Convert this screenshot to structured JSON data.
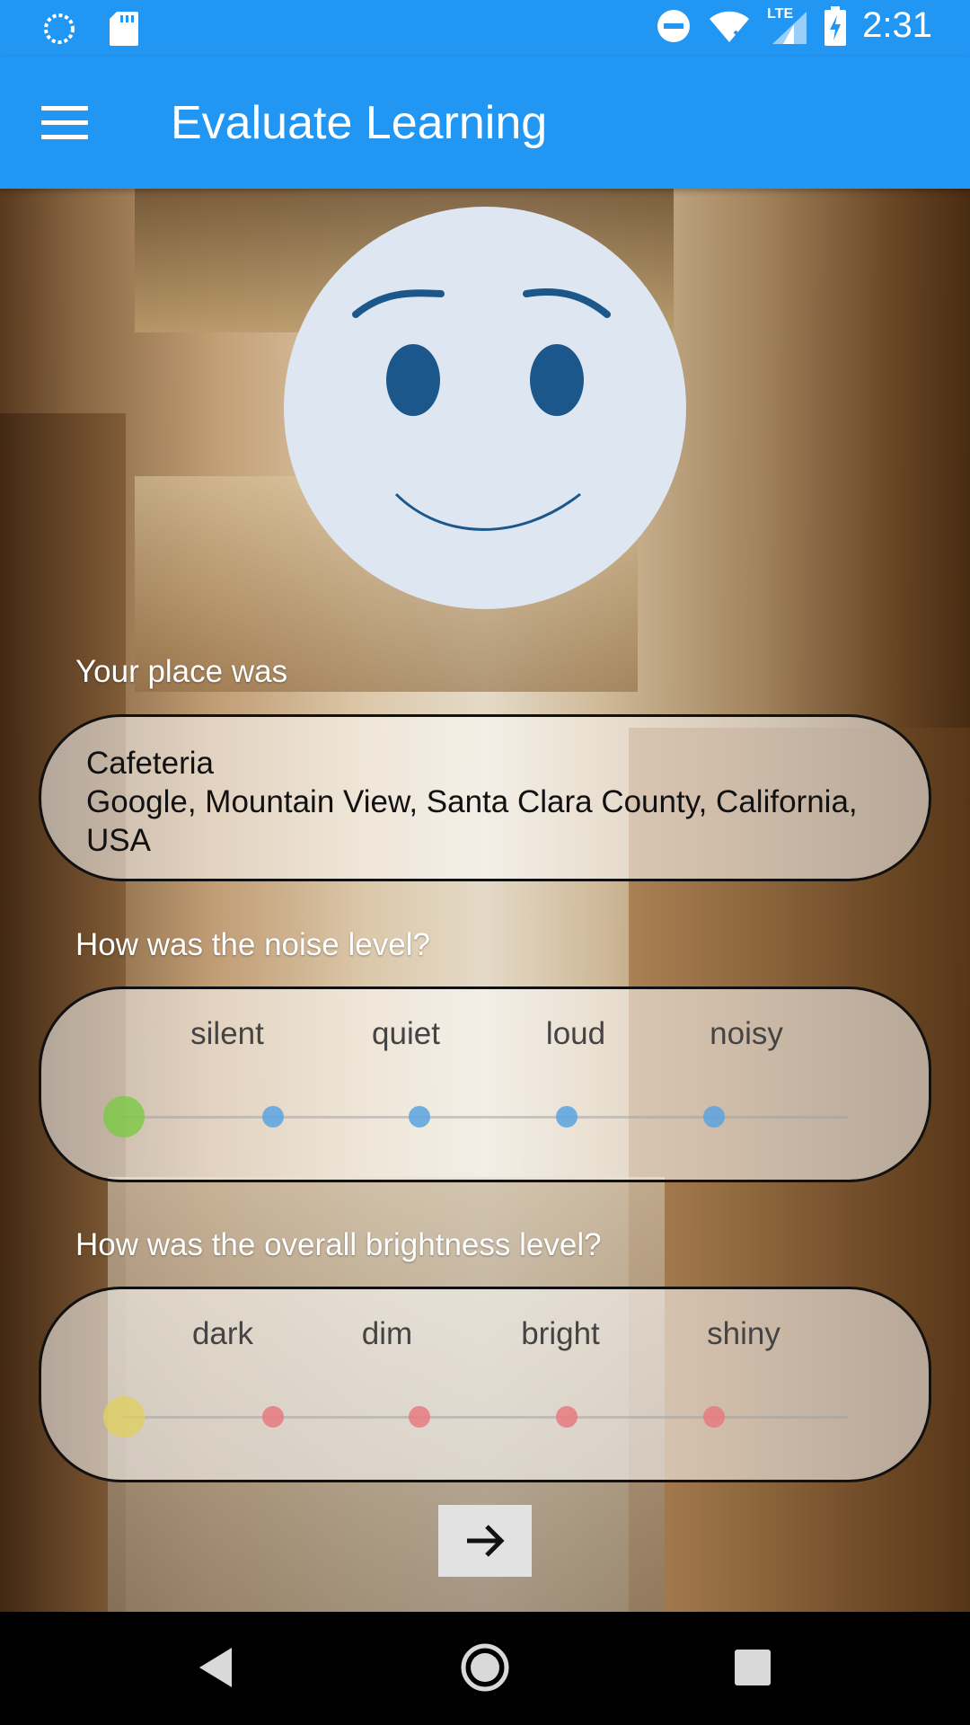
{
  "status_bar": {
    "time": "2:31",
    "network": "LTE",
    "icons": [
      "loading-icon",
      "sd-card-icon",
      "do-not-disturb-icon",
      "wifi-off-icon",
      "signal-icon",
      "battery-charging-icon"
    ]
  },
  "app_bar": {
    "title": "Evaluate Learning",
    "menu_icon": "hamburger-menu-icon"
  },
  "place": {
    "question": "Your place was",
    "name": "Cafeteria",
    "address": "Google, Mountain View, Santa Clara County, California, USA"
  },
  "noise": {
    "question": "How was the noise level?",
    "options": [
      "silent",
      "quiet",
      "loud",
      "noisy"
    ],
    "selected_index": 0,
    "selected_color": "#7ac943",
    "dot_color": "#5aa3e0"
  },
  "brightness": {
    "question": "How was the overall brightness level?",
    "options": [
      "dark",
      "dim",
      "bright",
      "shiny"
    ],
    "selected_index": 0,
    "selected_color": "#e0d060",
    "dot_color": "#e87a80"
  },
  "next_button": {
    "icon": "arrow-right-icon"
  },
  "nav": {
    "icons": [
      "back-icon",
      "home-icon",
      "recents-icon"
    ]
  },
  "colors": {
    "primary": "#2196F3",
    "smiley_face": "#dde6f1",
    "smiley_features": "#1c578c"
  }
}
